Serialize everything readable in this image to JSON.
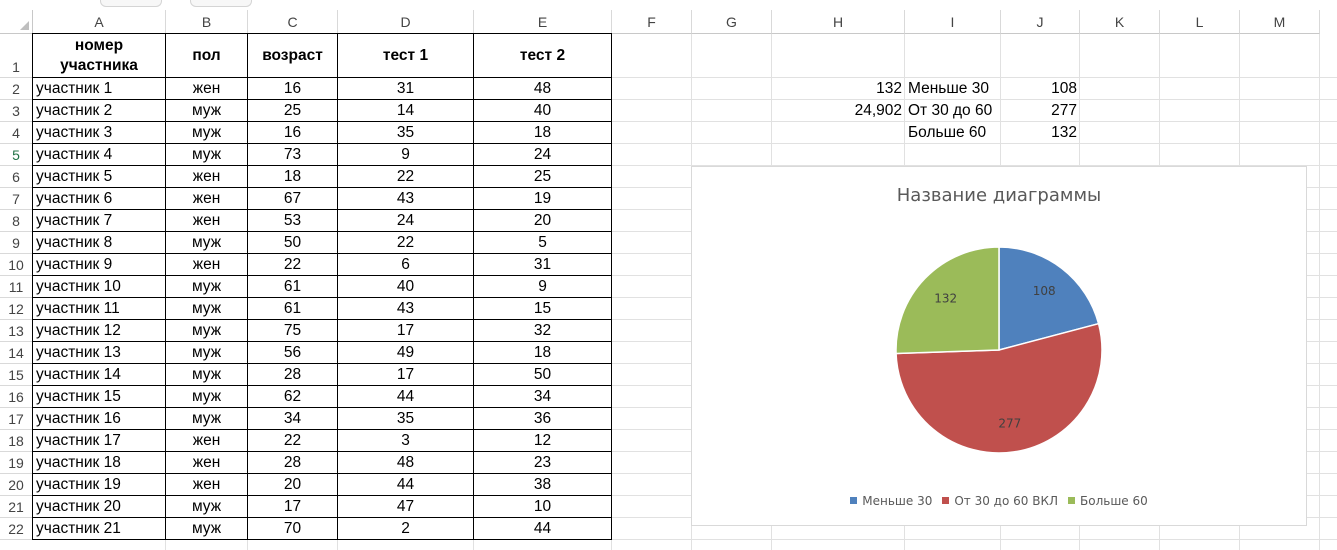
{
  "columns": [
    "A",
    "B",
    "C",
    "D",
    "E",
    "F",
    "G",
    "H",
    "I",
    "J",
    "K",
    "L",
    "M"
  ],
  "rows": [
    "1",
    "2",
    "3",
    "4",
    "5",
    "6",
    "7",
    "8",
    "9",
    "10",
    "11",
    "12",
    "13",
    "14",
    "15",
    "16",
    "17",
    "18",
    "19",
    "20",
    "21",
    "22"
  ],
  "table": {
    "headers": [
      "номер участника",
      "пол",
      "возраст",
      "тест 1",
      "тест 2"
    ],
    "data": [
      [
        "участник 1",
        "жен",
        "16",
        "31",
        "48"
      ],
      [
        "участник 2",
        "муж",
        "25",
        "14",
        "40"
      ],
      [
        "участник 3",
        "муж",
        "16",
        "35",
        "18"
      ],
      [
        "участник 4",
        "муж",
        "73",
        "9",
        "24"
      ],
      [
        "участник 5",
        "жен",
        "18",
        "22",
        "25"
      ],
      [
        "участник 6",
        "жен",
        "67",
        "43",
        "19"
      ],
      [
        "участник 7",
        "жен",
        "53",
        "24",
        "20"
      ],
      [
        "участник 8",
        "муж",
        "50",
        "22",
        "5"
      ],
      [
        "участник 9",
        "жен",
        "22",
        "6",
        "31"
      ],
      [
        "участник 10",
        "муж",
        "61",
        "40",
        "9"
      ],
      [
        "участник 11",
        "муж",
        "61",
        "43",
        "15"
      ],
      [
        "участник 12",
        "муж",
        "75",
        "17",
        "32"
      ],
      [
        "участник 13",
        "муж",
        "56",
        "49",
        "18"
      ],
      [
        "участник 14",
        "муж",
        "28",
        "17",
        "50"
      ],
      [
        "участник 15",
        "муж",
        "62",
        "44",
        "34"
      ],
      [
        "участник 16",
        "муж",
        "34",
        "35",
        "36"
      ],
      [
        "участник 17",
        "жен",
        "22",
        "3",
        "12"
      ],
      [
        "участник 18",
        "жен",
        "28",
        "48",
        "23"
      ],
      [
        "участник 19",
        "жен",
        "20",
        "44",
        "38"
      ],
      [
        "участник 20",
        "муж",
        "17",
        "47",
        "10"
      ],
      [
        "участник 21",
        "муж",
        "70",
        "2",
        "44"
      ]
    ]
  },
  "side": {
    "h2": "132",
    "h3": "24,902",
    "i2": "Меньше 30",
    "i3": "От 30 до 60",
    "i4": "Больше 60",
    "j2": "108",
    "j3": "277",
    "j4": "132"
  },
  "colors": {
    "series1": "#4f81bd",
    "series2": "#c0504d",
    "series3": "#9bbb59"
  },
  "chart_data": {
    "type": "pie",
    "title": "Название диаграммы",
    "categories": [
      "Меньше 30",
      "От 30 до 60 ВКЛ",
      "Больше 60"
    ],
    "values": [
      108,
      277,
      132
    ],
    "data_labels": [
      "108",
      "277",
      "132"
    ],
    "legend": "bottom"
  }
}
